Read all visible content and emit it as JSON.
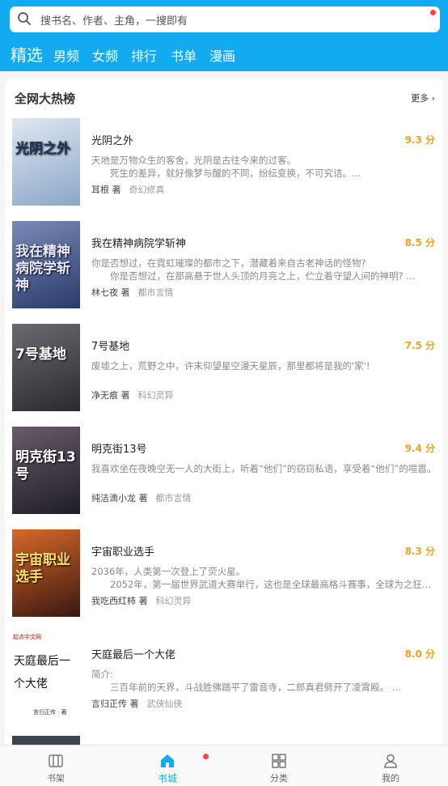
{
  "search": {
    "placeholder": "搜书名、作者、主角，一搜即有"
  },
  "tabs": [
    "精选",
    "男频",
    "女频",
    "排行",
    "书单",
    "漫画"
  ],
  "section": {
    "title": "全网大热榜",
    "more": "更多"
  },
  "books": [
    {
      "title": "光阴之外",
      "score": "9.3 分",
      "desc": [
        "天地是万物众生的客舍，光阴是古往今来的过客。",
        "　　死生的差异，就好像梦与醒的不同，纷纭变换，不可究诘。…"
      ],
      "author": "耳根 著",
      "genre": "奇幻修真",
      "cover": {
        "text": "光阴之外",
        "bg1": "#8aa7c8",
        "bg2": "#dfe7f0",
        "fg": "#1c3558"
      }
    },
    {
      "title": "我在精神病院学斩神",
      "score": "8.5 分",
      "desc": [
        "你是否想过，在霓虹璀璨的都市之下，潜藏着来自古老神话的怪物?",
        "　　你是否想过，在那高悬于世人头顶的月亮之上，伫立着守望人间的神明? …"
      ],
      "author": "林七夜 著",
      "genre": "都市言情",
      "cover": {
        "text": "我在精神病院学斩神",
        "bg1": "#2a3a6a",
        "bg2": "#7a8ab8",
        "fg": "#e8e8ff"
      }
    },
    {
      "title": "7号基地",
      "score": "7.5 分",
      "desc": [
        "废墟之上，荒野之中，许末仰望星空漫天星辰，那里都将是我的'家'!"
      ],
      "author": "净无痕 著",
      "genre": "科幻灵异",
      "cover": {
        "text": "7号基地",
        "bg1": "#2b2b2e",
        "bg2": "#6a6a70",
        "fg": "#ffffff"
      }
    },
    {
      "title": "明克街13号",
      "score": "9.4 分",
      "desc": [
        "我喜欢坐在夜晚空无一人的大街上，听着“他们”的窃窃私语，享受着“他们”的喧嚣。"
      ],
      "author": "纯洁滴小龙 著",
      "genre": "都市言情",
      "cover": {
        "text": "明克街13号",
        "bg1": "#1e1e28",
        "bg2": "#6a5a6a",
        "fg": "#ffffff"
      }
    },
    {
      "title": "宇宙职业选手",
      "score": "8.3 分",
      "desc": [
        "2036年，人类第一次登上了荧火星。",
        "　　2052年，第一届世界武道大赛举行，这也是全球最高格斗赛事，全球为之狂…"
      ],
      "author": "我吃西红柿 著",
      "genre": "科幻灵异",
      "cover": {
        "text": "宇宙职业选手",
        "bg1": "#3a1810",
        "bg2": "#d8682a",
        "fg": "#ffe070"
      }
    },
    {
      "title": "天庭最后一个大佬",
      "score": "8.0 分",
      "desc": [
        "简介:",
        "　　三百年前的天界，斗战胜佛踏平了雷音寺，二郎真君劈开了凌霄殿。 …"
      ],
      "author": "言归正传 著",
      "genre": "武侠仙侠",
      "cover": {
        "text": "天庭最后一个大佬",
        "sub": "言归正传 · 著",
        "badge": "起点中文网",
        "bg1": "#ffffff",
        "bg2": "#ffffff",
        "fg": "#111111"
      }
    }
  ],
  "bottom_nav": [
    {
      "label": "书架",
      "icon": "bookshelf-icon"
    },
    {
      "label": "书城",
      "icon": "bookstore-icon"
    },
    {
      "label": "分类",
      "icon": "category-icon"
    },
    {
      "label": "我的",
      "icon": "profile-icon"
    }
  ],
  "colors": {
    "primary": "#12aaf0",
    "score": "#f2a01f",
    "dot": "#ff4444"
  }
}
